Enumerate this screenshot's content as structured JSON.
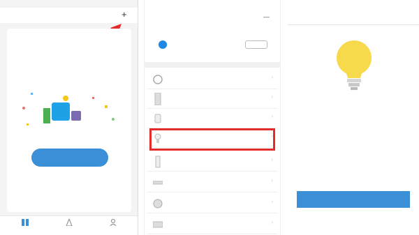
{
  "panel1": {
    "status": {
      "carrier": "",
      "time": "",
      "battery": ""
    },
    "header_title": "",
    "card_title": "",
    "add_button_label": "",
    "help_link": "",
    "tabs": [
      {
        "label": ""
      },
      {
        "label": ""
      },
      {
        "label": ""
      }
    ],
    "colors": {
      "accent": "#3a8fd6",
      "arrow": "#e52a2a"
    }
  },
  "panel2": {
    "status": {
      "carrier": "",
      "time": "",
      "battery": ""
    },
    "cancel_label": "",
    "title": "",
    "banner_text": "",
    "banner_button": "",
    "items": [
      {
        "label": "",
        "icon": "circle-device-icon"
      },
      {
        "label": "",
        "icon": "panel-device-icon"
      },
      {
        "label": "",
        "icon": "socket-device-icon"
      },
      {
        "label": "",
        "icon": "bulb-device-icon"
      },
      {
        "label": "",
        "icon": "strip-device-icon"
      },
      {
        "label": "",
        "icon": "bar-device-icon"
      },
      {
        "label": "",
        "icon": "round-device-icon"
      },
      {
        "label": "",
        "icon": "box-device-icon"
      }
    ],
    "highlight_color": "#e52a2a"
  },
  "panel3": {
    "status": {
      "carrier": "",
      "time": "",
      "battery": ""
    },
    "back_label": "",
    "title": "",
    "right_label": "",
    "instruction": "",
    "link_text": "",
    "confirm_button": "",
    "colors": {
      "bulb": "#f7d94c",
      "accent": "#3a8fd6"
    }
  }
}
